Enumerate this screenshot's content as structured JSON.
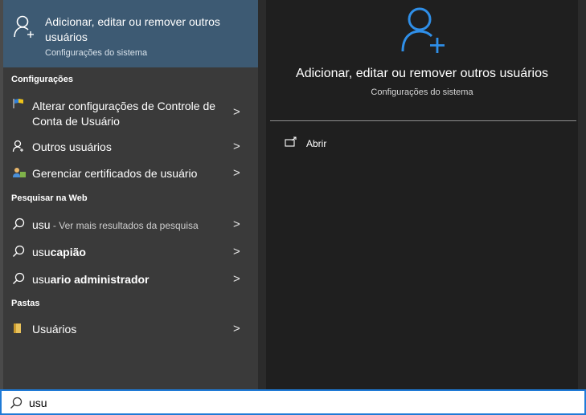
{
  "best_match": {
    "title": "Adicionar, editar ou remover outros usuários",
    "subtitle": "Configurações do sistema",
    "icon": "user-add-icon"
  },
  "sections": {
    "settings": "Configurações",
    "web": "Pesquisar na Web",
    "folders": "Pastas"
  },
  "settings_items": [
    {
      "label": "Alterar configurações de Controle de Conta de Usuário",
      "icon": "uac-flag-icon"
    },
    {
      "label": "Outros usuários",
      "icon": "user-icon"
    },
    {
      "label": "Gerenciar certificados de usuário",
      "icon": "certificate-icon"
    }
  ],
  "web_items": [
    {
      "query": "usu",
      "hint": " - Ver mais resultados da pesquisa",
      "icon": "search-icon"
    },
    {
      "prefix": "usu",
      "bold": "capião",
      "icon": "search-icon"
    },
    {
      "prefix": "usu",
      "bold": "ario administrador",
      "icon": "search-icon"
    }
  ],
  "folder_items": [
    {
      "label": "Usuários",
      "icon": "folder-icon"
    }
  ],
  "detail": {
    "title": "Adicionar, editar ou remover outros usuários",
    "subtitle": "Configurações do sistema",
    "open_label": "Abrir",
    "icon": "user-add-icon"
  },
  "search": {
    "value": "usu"
  },
  "chevron": ">",
  "colors": {
    "accent": "#1f7ad6",
    "selected": "#3d5a73"
  }
}
